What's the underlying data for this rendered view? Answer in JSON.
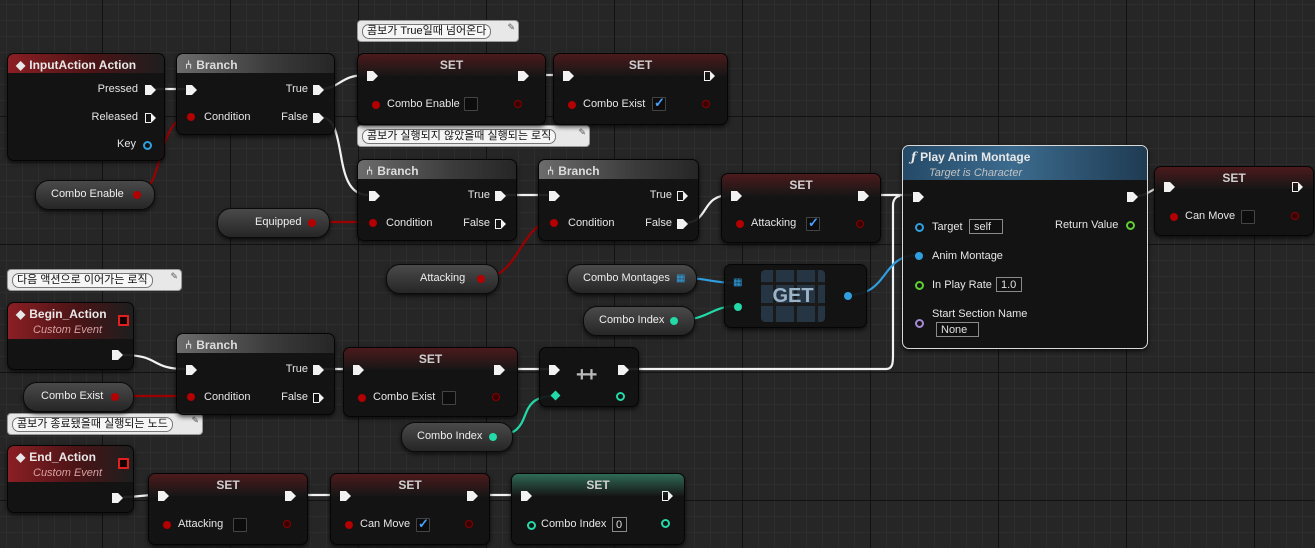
{
  "comments": {
    "c1": "콤보가 True일때 넘어온다",
    "c2": "콤보가 실행되지 않았을때 실행되는 로직",
    "c3": "다음 액션으로 이어가는 로직",
    "c4": "콤보가 종료됐을때 실행되는 노드"
  },
  "comment_icon": "pin-icon",
  "input_action": {
    "title": "InputAction Action",
    "pins": [
      "Pressed",
      "Released",
      "Key"
    ]
  },
  "branch": {
    "title": "Branch",
    "condition": "Condition",
    "true": "True",
    "false": "False"
  },
  "set": {
    "title": "SET"
  },
  "vars": {
    "combo_enable": "Combo Enable",
    "combo_exist": "Combo Exist",
    "equipped": "Equipped",
    "attacking": "Attacking",
    "combo_montages": "Combo Montages",
    "combo_index": "Combo Index",
    "can_move": "Can Move"
  },
  "get_node": {
    "label": "GET"
  },
  "increment": {
    "label": "++"
  },
  "begin_event": {
    "title": "Begin_Action",
    "subtitle": "Custom Event"
  },
  "end_event": {
    "title": "End_Action",
    "subtitle": "Custom Event"
  },
  "play_montage": {
    "title": "Play Anim Montage",
    "subtitle": "Target is Character",
    "target": "Target",
    "target_value": "self",
    "anim_montage": "Anim Montage",
    "in_play_rate": "In Play Rate",
    "in_play_rate_value": "1.0",
    "start_section": "Start Section Name",
    "start_section_value": "None",
    "return_value": "Return Value"
  },
  "checkbox_states": {
    "set1_combo_enable": false,
    "set2_combo_exist": true,
    "set3_attacking": true,
    "set4_can_move": false,
    "set5_combo_exist": false,
    "set6_attacking": false,
    "set7_can_move": true
  },
  "set8_combo_index_value": "0",
  "colors": {
    "exec": "#f2f2f2",
    "bool": "#b30000",
    "int": "#23d9a8",
    "object": "#2f9fe0",
    "float": "#5fcf33",
    "name": "#a889d6",
    "event": "#8b1f24",
    "function": "#3c6b8e"
  }
}
